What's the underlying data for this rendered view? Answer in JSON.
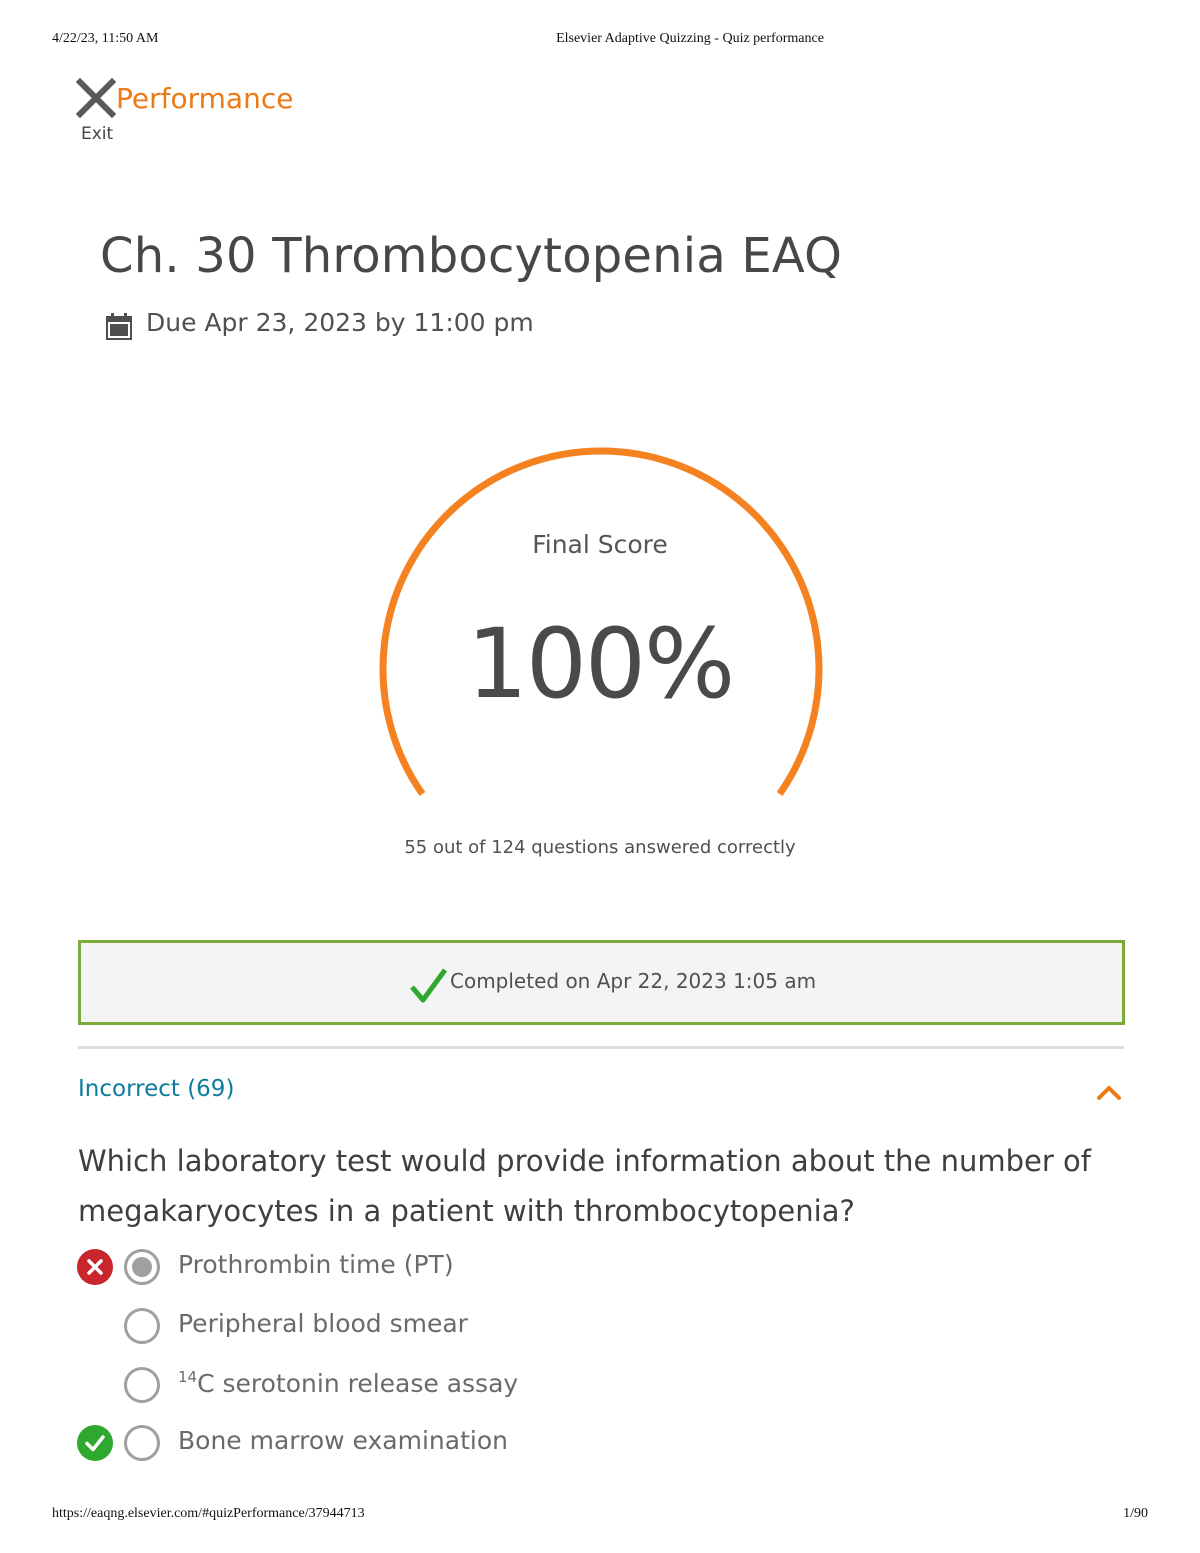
{
  "print_header": {
    "datetime": "4/22/23, 11:50 AM",
    "title": "Elsevier Adaptive Quizzing - Quiz performance"
  },
  "print_footer": {
    "url": "https://eaqng.elsevier.com/#quizPerformance/37944713",
    "page": "1/90"
  },
  "nav": {
    "title": "Performance",
    "exit_label": "Exit",
    "exit_icon": "close-icon"
  },
  "quiz": {
    "title": "Ch. 30 Thrombocytopenia EAQ",
    "due": "Due Apr 23, 2023 by 11:00 pm",
    "due_icon": "calendar-icon"
  },
  "score": {
    "label": "Final Score",
    "value": "100%",
    "fraction": 1.0,
    "detail": "55 out of 124 questions answered correctly",
    "gauge_color": "#f58220"
  },
  "completion": {
    "text": "Completed on Apr 22, 2023 1:05 am",
    "border_color": "#7cab3a",
    "check_color": "#2ea82e"
  },
  "section": {
    "label": "Incorrect (69)",
    "label_color": "#0c7b9d",
    "toggle_icon": "chevron-up-icon",
    "toggle_color": "#ec7a15"
  },
  "question": {
    "text": "Which laboratory test would provide information about the number of megakaryocytes in a patient with thrombocytopenia?",
    "options": [
      {
        "text": "Prothrombin time (PT)",
        "selected": true,
        "status": "incorrect"
      },
      {
        "text": "Peripheral blood smear",
        "selected": false,
        "status": "none"
      },
      {
        "sup": "14",
        "text": "C serotonin release assay",
        "selected": false,
        "status": "none"
      },
      {
        "text": "Bone marrow examination",
        "selected": false,
        "status": "correct"
      }
    ]
  }
}
